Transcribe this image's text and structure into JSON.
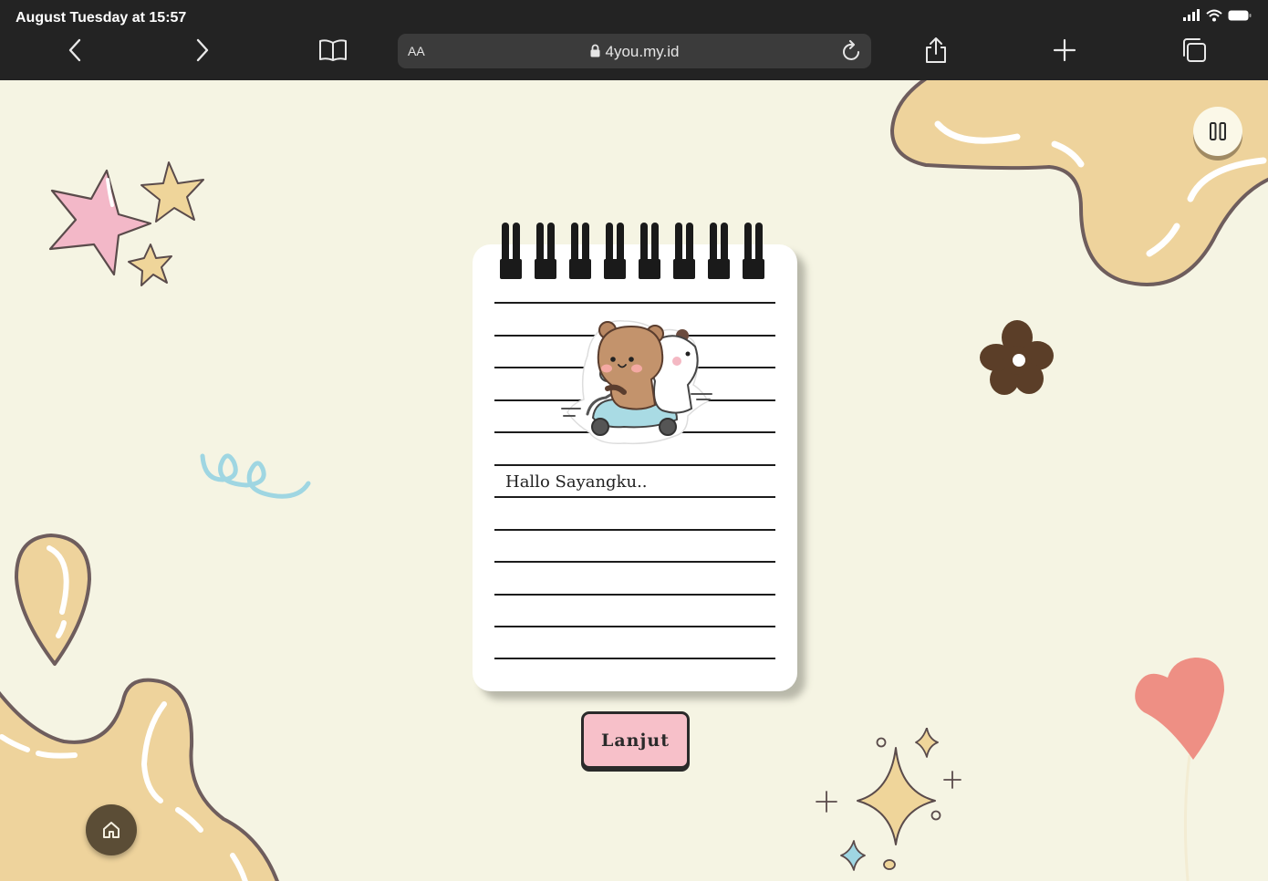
{
  "status_bar": {
    "time": "August Tuesday at 15:57"
  },
  "browser": {
    "url_text": "4you.my.id",
    "reader_label": "AA"
  },
  "page": {
    "greeting": "Hallo Sayangku..",
    "next_button_label": "Lanjut"
  },
  "colors": {
    "background": "#f5f4e3",
    "blob": "#eed39c",
    "blob_outline": "#6e5d5d",
    "button_pink": "#f7c0c9",
    "heart": "#ee8f84",
    "star_pink": "#f3b8c8",
    "star_tan": "#efd59a",
    "flower": "#5b3e28",
    "squiggle": "#9fd6e2",
    "home_button": "#5b4d36"
  }
}
